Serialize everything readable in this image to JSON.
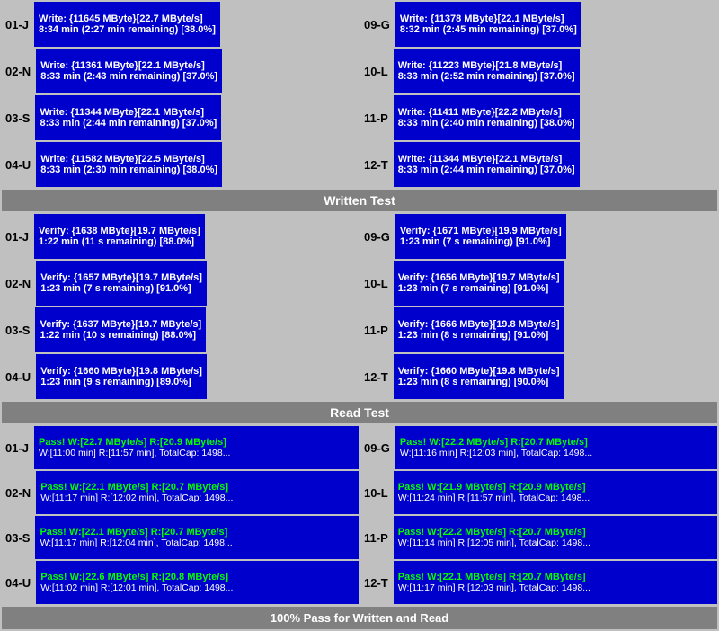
{
  "sections": {
    "write": {
      "rows": [
        {
          "left": {
            "id": "01-J",
            "line1": "Write: {11645 MByte}[22.7 MByte/s]",
            "line2": "8:34 min (2:27 min remaining)  [38.0%]"
          },
          "right": {
            "id": "09-G",
            "line1": "Write: {11378 MByte}[22.1 MByte/s]",
            "line2": "8:32 min (2:45 min remaining)  [37.0%]"
          }
        },
        {
          "left": {
            "id": "02-N",
            "line1": "Write: {11361 MByte}[22.1 MByte/s]",
            "line2": "8:33 min (2:43 min remaining)  [37.0%]"
          },
          "right": {
            "id": "10-L",
            "line1": "Write: {11223 MByte}[21.8 MByte/s]",
            "line2": "8:33 min (2:52 min remaining)  [37.0%]"
          }
        },
        {
          "left": {
            "id": "03-S",
            "line1": "Write: {11344 MByte}[22.1 MByte/s]",
            "line2": "8:33 min (2:44 min remaining)  [37.0%]"
          },
          "right": {
            "id": "11-P",
            "line1": "Write: {11411 MByte}[22.2 MByte/s]",
            "line2": "8:33 min (2:40 min remaining)  [38.0%]"
          }
        },
        {
          "left": {
            "id": "04-U",
            "line1": "Write: {11582 MByte}[22.5 MByte/s]",
            "line2": "8:33 min (2:30 min remaining)  [38.0%]"
          },
          "right": {
            "id": "12-T",
            "line1": "Write: {11344 MByte}[22.1 MByte/s]",
            "line2": "8:33 min (2:44 min remaining)  [37.0%]"
          }
        }
      ],
      "divider": "Written Test"
    },
    "verify": {
      "rows": [
        {
          "left": {
            "id": "01-J",
            "line1": "Verify: {1638 MByte}[19.7 MByte/s]",
            "line2": "1:22 min (11 s remaining)  [88.0%]"
          },
          "right": {
            "id": "09-G",
            "line1": "Verify: {1671 MByte}[19.9 MByte/s]",
            "line2": "1:23 min (7 s remaining)   [91.0%]"
          }
        },
        {
          "left": {
            "id": "02-N",
            "line1": "Verify: {1657 MByte}[19.7 MByte/s]",
            "line2": "1:23 min (7 s remaining)   [91.0%]"
          },
          "right": {
            "id": "10-L",
            "line1": "Verify: {1656 MByte}[19.7 MByte/s]",
            "line2": "1:23 min (7 s remaining)   [91.0%]"
          }
        },
        {
          "left": {
            "id": "03-S",
            "line1": "Verify: {1637 MByte}[19.7 MByte/s]",
            "line2": "1:22 min (10 s remaining)  [88.0%]"
          },
          "right": {
            "id": "11-P",
            "line1": "Verify: {1666 MByte}[19.8 MByte/s]",
            "line2": "1:23 min (8 s remaining)   [91.0%]"
          }
        },
        {
          "left": {
            "id": "04-U",
            "line1": "Verify: {1660 MByte}[19.8 MByte/s]",
            "line2": "1:23 min (9 s remaining)   [89.0%]"
          },
          "right": {
            "id": "12-T",
            "line1": "Verify: {1660 MByte}[19.8 MByte/s]",
            "line2": "1:23 min (8 s remaining)   [90.0%]"
          }
        }
      ],
      "divider": "Read Test"
    },
    "pass": {
      "rows": [
        {
          "left": {
            "id": "01-J",
            "line1": "Pass! W:[22.7 MByte/s] R:[20.9 MByte/s]",
            "line2": "W:[11:00 min] R:[11:57 min], TotalCap: 1498..."
          },
          "right": {
            "id": "09-G",
            "line1": "Pass! W:[22.2 MByte/s] R:[20.7 MByte/s]",
            "line2": "W:[11:16 min] R:[12:03 min], TotalCap: 1498..."
          }
        },
        {
          "left": {
            "id": "02-N",
            "line1": "Pass! W:[22.1 MByte/s] R:[20.7 MByte/s]",
            "line2": "W:[11:17 min] R:[12:02 min], TotalCap: 1498..."
          },
          "right": {
            "id": "10-L",
            "line1": "Pass! W:[21.9 MByte/s] R:[20.9 MByte/s]",
            "line2": "W:[11:24 min] R:[11:57 min], TotalCap: 1498..."
          }
        },
        {
          "left": {
            "id": "03-S",
            "line1": "Pass! W:[22.1 MByte/s] R:[20.7 MByte/s]",
            "line2": "W:[11:17 min] R:[12:04 min], TotalCap: 1498..."
          },
          "right": {
            "id": "11-P",
            "line1": "Pass! W:[22.2 MByte/s] R:[20.7 MByte/s]",
            "line2": "W:[11:14 min] R:[12:05 min], TotalCap: 1498..."
          }
        },
        {
          "left": {
            "id": "04-U",
            "line1": "Pass! W:[22.6 MByte/s] R:[20.8 MByte/s]",
            "line2": "W:[11:02 min] R:[12:01 min], TotalCap: 1498..."
          },
          "right": {
            "id": "12-T",
            "line1": "Pass! W:[22.1 MByte/s] R:[20.7 MByte/s]",
            "line2": "W:[11:17 min] R:[12:03 min], TotalCap: 1498..."
          }
        }
      ]
    }
  },
  "dividers": {
    "written": "Written Test",
    "read": "Read Test"
  },
  "bottom": "100% Pass for Written and Read"
}
